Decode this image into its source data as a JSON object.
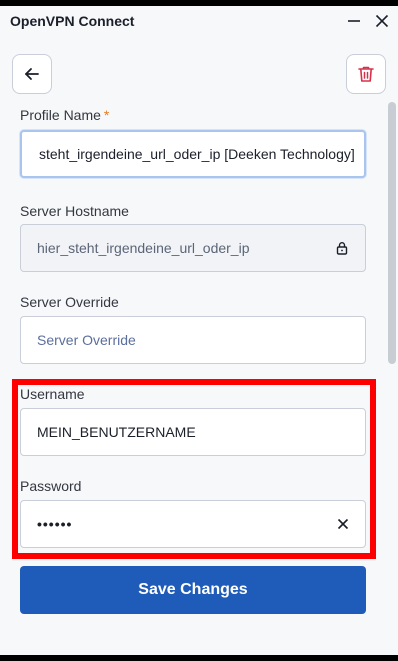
{
  "window": {
    "title": "OpenVPN Connect"
  },
  "toolbar": {
    "back_icon": "arrow-left-icon",
    "delete_icon": "trash-icon",
    "delete_color": "#d8304a"
  },
  "form": {
    "profile_name": {
      "label": "Profile Name",
      "required_marker": "*",
      "value": "steht_irgendeine_url_oder_ip [Deeken Technology]"
    },
    "server_hostname": {
      "label": "Server Hostname",
      "value": "hier_steht_irgendeine_url_oder_ip",
      "icon": "lock-icon"
    },
    "server_override": {
      "label": "Server Override",
      "placeholder": "Server Override"
    },
    "username": {
      "label": "Username",
      "value": "MEIN_BENUTZERNAME"
    },
    "password": {
      "label": "Password",
      "value": "••••••",
      "clear_icon": "close-icon"
    },
    "save_label": "Save Changes"
  },
  "colors": {
    "accent": "#1f5bb8",
    "highlight": "#ff0000",
    "required": "#e57b1c"
  }
}
